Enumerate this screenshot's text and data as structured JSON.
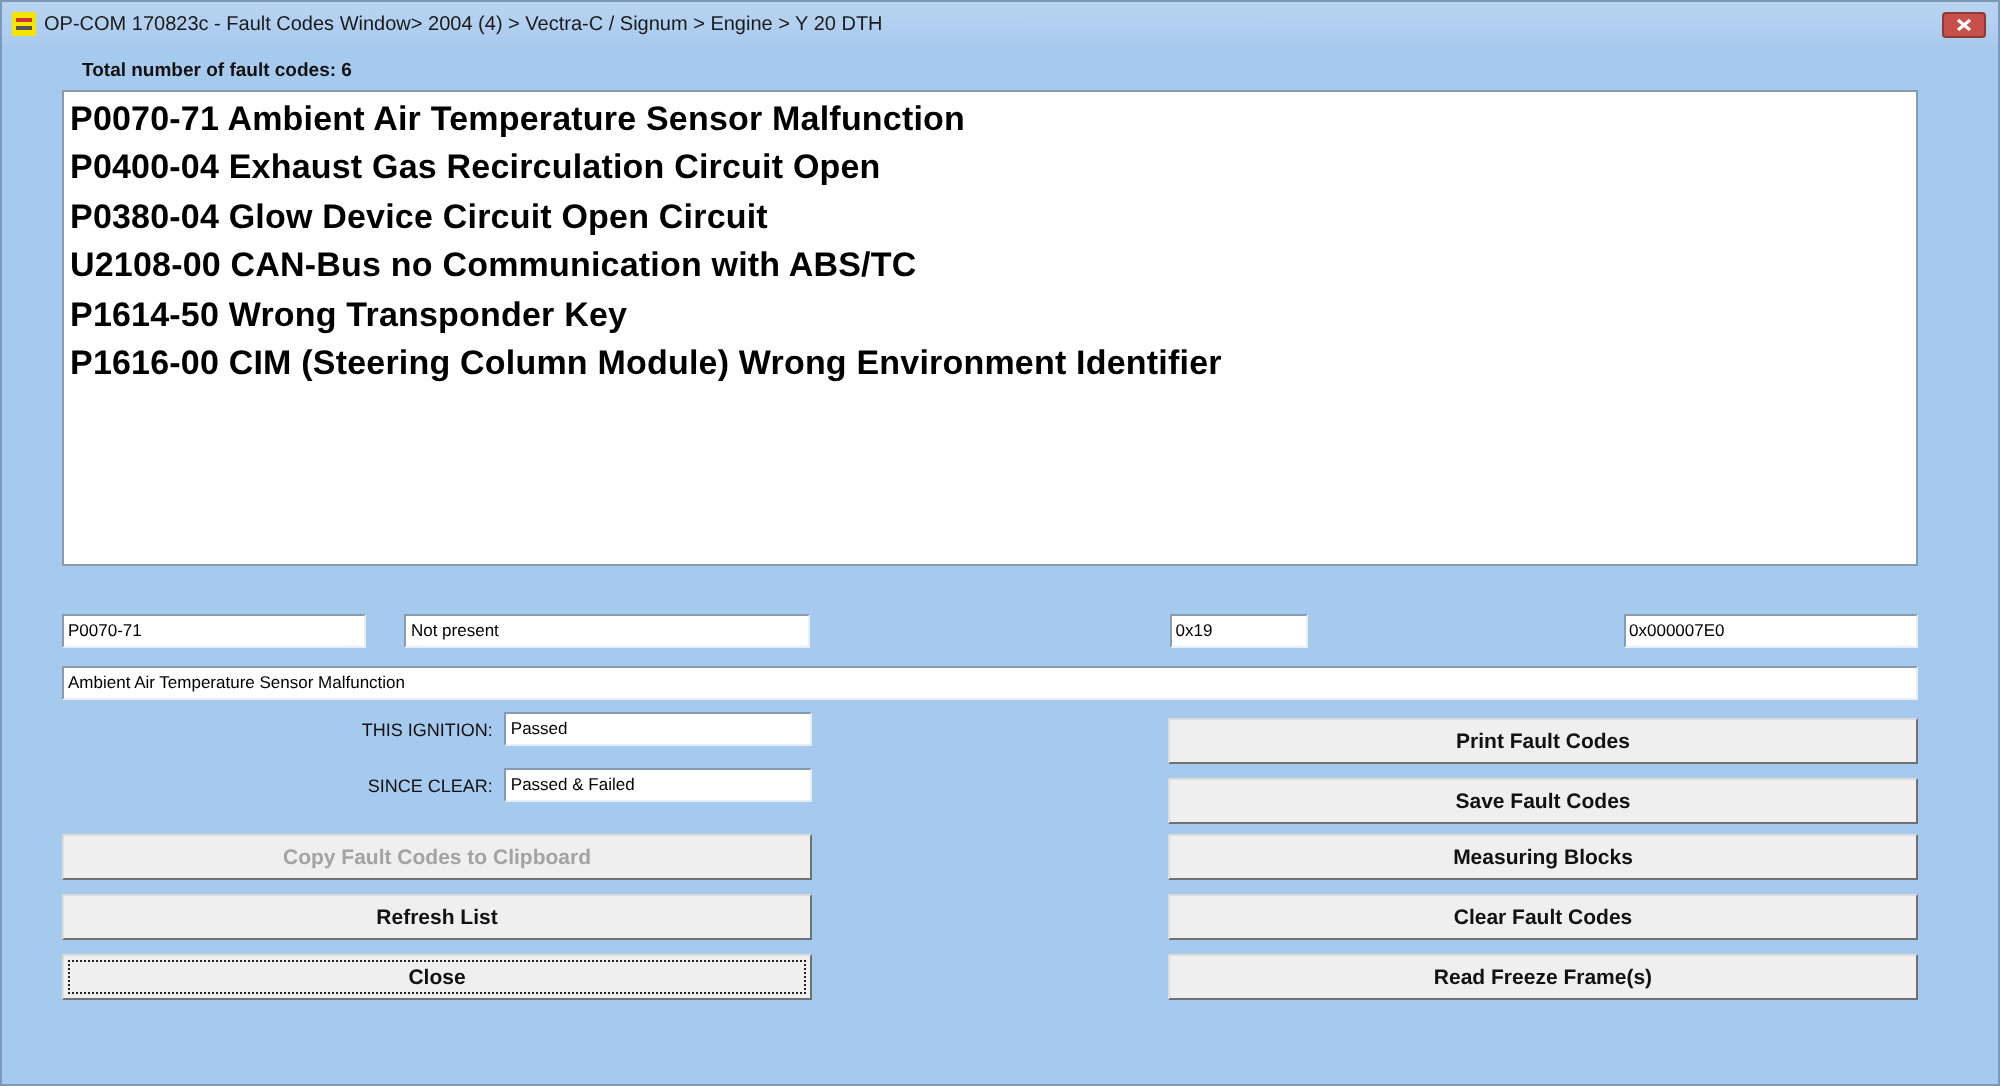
{
  "window": {
    "title": "OP-COM 170823c - Fault Codes Window> 2004 (4) > Vectra-C / Signum > Engine > Y 20 DTH",
    "app_icon": {
      "kind": "logo"
    }
  },
  "total_label": "Total number of fault codes:  6",
  "fault_codes": [
    {
      "text": "P0070-71 Ambient Air Temperature Sensor Malfunction"
    },
    {
      "text": "P0400-04 Exhaust Gas Recirculation Circuit Open"
    },
    {
      "text": "P0380-04 Glow Device Circuit Open Circuit"
    },
    {
      "text": "U2108-00 CAN-Bus no Communication with ABS/TC"
    },
    {
      "text": "P1614-50 Wrong Transponder Key"
    },
    {
      "text": "P1616-00 CIM (Steering Column Module) Wrong Environment Identifier"
    }
  ],
  "details": {
    "code": "P0070-71",
    "status": "Not present",
    "field_3": "0x19",
    "field_4": "0x000007E0",
    "description": "Ambient Air Temperature Sensor Malfunction"
  },
  "ignition_rows": [
    {
      "label": "THIS IGNITION:",
      "value": "Passed"
    },
    {
      "label": "SINCE CLEAR:",
      "value": "Passed & Failed"
    }
  ],
  "left_buttons": [
    {
      "label": "Copy Fault Codes to Clipboard",
      "disabled": true,
      "focused": false
    },
    {
      "label": "Refresh List",
      "disabled": false,
      "focused": false
    },
    {
      "label": "Close",
      "disabled": false,
      "focused": true
    }
  ],
  "right_buttons": [
    {
      "label": "Print Fault Codes",
      "disabled": false,
      "focused": false
    },
    {
      "label": "Save Fault Codes",
      "disabled": false,
      "focused": false
    },
    {
      "label": "Measuring Blocks",
      "disabled": false,
      "focused": false
    },
    {
      "label": "Clear Fault Codes",
      "disabled": false,
      "focused": false
    },
    {
      "label": "Read Freeze Frame(s)",
      "disabled": false,
      "focused": false
    }
  ]
}
